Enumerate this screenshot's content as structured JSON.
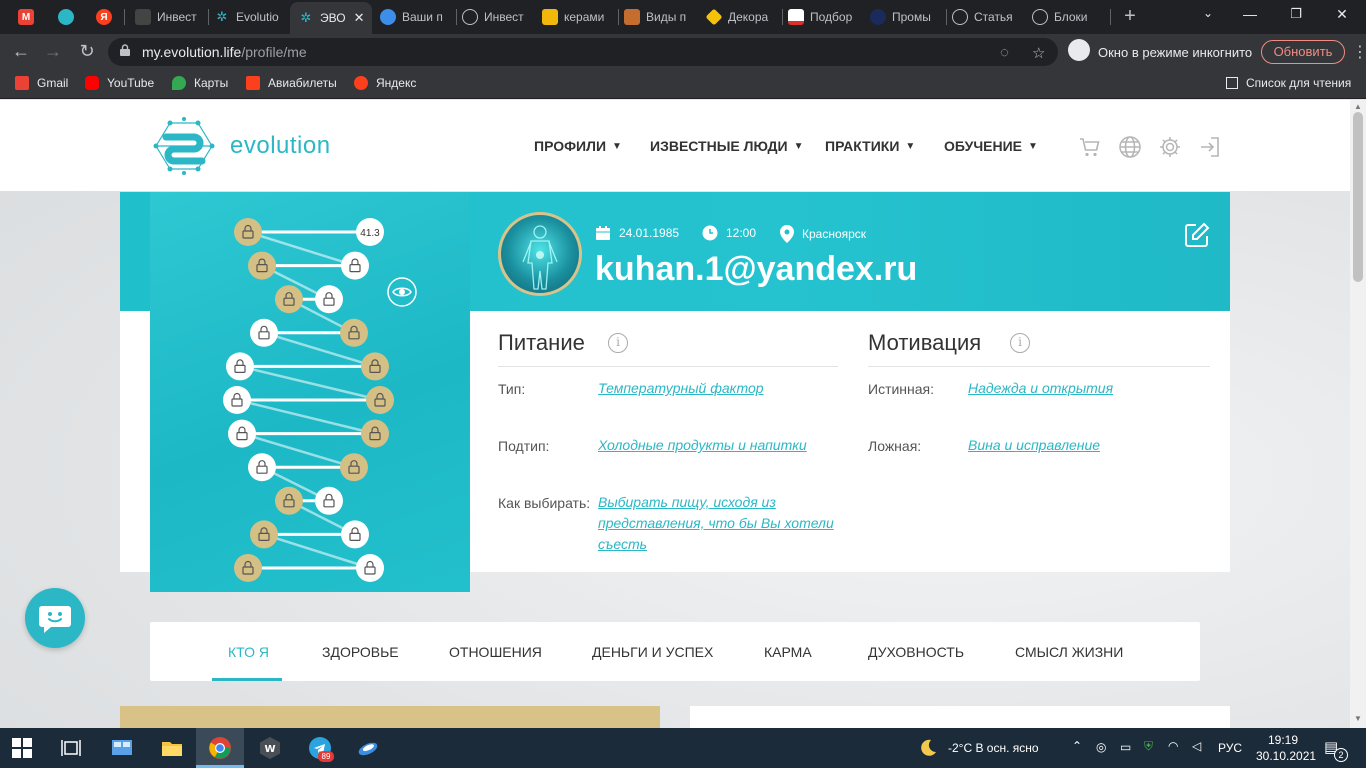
{
  "browser": {
    "tabs": [
      {
        "title": "",
        "icon": "gmail-icon",
        "color": "#ea4335"
      },
      {
        "title": "",
        "icon": "cloud-icon",
        "color": "#2bb7c6"
      },
      {
        "title": "",
        "icon": "yandex-icon",
        "color": "#fc3f1d"
      },
      {
        "title": "Инвест",
        "icon": "shield-icon",
        "color": "#444444"
      },
      {
        "title": "Evolutio",
        "icon": "evolution-icon",
        "color": "#2bb7c6"
      },
      {
        "title": "ЭВО",
        "icon": "evolution-icon",
        "color": "#2bb7c6",
        "active": true
      },
      {
        "title": "Ваши п",
        "icon": "search-icon",
        "color": "#3d8ee8"
      },
      {
        "title": "Инвест",
        "icon": "coin-icon",
        "color": "#777777"
      },
      {
        "title": "керами",
        "icon": "image-icon",
        "color": "#f2b70b"
      },
      {
        "title": "Виды п",
        "icon": "box-icon",
        "color": "#c56d2f"
      },
      {
        "title": "Декора",
        "icon": "diamond-icon",
        "color": "#f4c20d"
      },
      {
        "title": "Подбор",
        "icon": "chart-icon",
        "color": "#d9312b"
      },
      {
        "title": "Промы",
        "icon": "dot-icon",
        "color": "#1a2a5a"
      },
      {
        "title": "Статья",
        "icon": "globe-icon",
        "color": "#bdc1c6"
      },
      {
        "title": "Блоки",
        "icon": "globe-icon",
        "color": "#bdc1c6"
      }
    ],
    "url_host": "my.evolution.life",
    "url_path": "/profile/me",
    "incognito_label": "Окно в режиме инкогнито",
    "update_label": "Обновить",
    "bookmarks": [
      {
        "label": "Gmail",
        "color": "#ea4335"
      },
      {
        "label": "YouTube",
        "color": "#ff0000"
      },
      {
        "label": "Карты",
        "color": "#34a853"
      },
      {
        "label": "Авиабилеты",
        "color": "#fc3f1d"
      },
      {
        "label": "Яндекс",
        "color": "#fc3f1d"
      }
    ],
    "reading_list": "Список для чтения"
  },
  "site": {
    "brand": "evolution",
    "accent": "#2bb7c6",
    "nav": [
      "ПРОФИЛИ",
      "ИЗВЕСТНЫЕ ЛЮДИ",
      "ПРАКТИКИ",
      "ОБУЧЕНИЕ"
    ],
    "header_icons": [
      "cart-icon",
      "globe-icon",
      "gear-icon",
      "logout-icon"
    ]
  },
  "profile": {
    "dna_value": "41.3",
    "birth_date": "24.01.1985",
    "birth_time": "12:00",
    "city": "Красноярск",
    "email": "kuhan.1@yandex.ru",
    "nutrition": {
      "title": "Питание",
      "rows": [
        {
          "label": "Тип:",
          "value": "Температурный фактор"
        },
        {
          "label": "Подтип:",
          "value": "Холодные продукты и напитки"
        },
        {
          "label": "Как выбирать:",
          "value_lines": [
            "Выбирать пищу, исходя из",
            "представления, что бы Вы хотели",
            "съесть"
          ]
        }
      ]
    },
    "motivation": {
      "title": "Мотивация",
      "rows": [
        {
          "label": "Истинная:",
          "value": "Надежда и открытия"
        },
        {
          "label": "Ложная:",
          "value": "Вина и исправление"
        }
      ]
    }
  },
  "profile_tabs": [
    "КТО Я",
    "ЗДОРОВЬЕ",
    "ОТНОШЕНИЯ",
    "ДЕНЬГИ И УСПЕХ",
    "КАРМА",
    "ДУХОВНОСТЬ",
    "СМЫСЛ ЖИЗНИ"
  ],
  "taskbar": {
    "weather": "-2°C  В осн. ясно",
    "language": "РУС",
    "time": "19:19",
    "date": "30.10.2021",
    "notifications": "2",
    "telegram_badge": "89"
  }
}
